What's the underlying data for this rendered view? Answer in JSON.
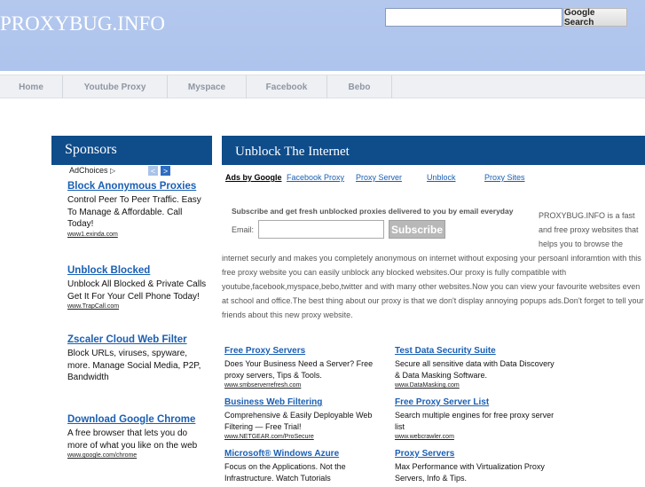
{
  "header": {
    "logo": "PROXYBUG.INFO",
    "search_button": "Google Search"
  },
  "nav": [
    "Home",
    "Youtube Proxy",
    "Myspace",
    "Facebook",
    "Bebo"
  ],
  "sidebar": {
    "title": "Sponsors",
    "adchoices": "AdChoices",
    "ads": [
      {
        "title": "Block Anonymous Proxies",
        "desc": "Control Peer To Peer Traffic. Easy To Manage & Affordable. Call Today!",
        "url": "www1.exinda.com"
      },
      {
        "title": "Unblock Blocked",
        "desc": "Unblock All Blocked & Private Calls Get It For Your Cell Phone Today!",
        "url": "www.TrapCall.com"
      },
      {
        "title": "Zscaler Cloud Web Filter",
        "desc": "Block URLs, viruses, spyware, more. Manage Social Media, P2P, Bandwidth",
        "url": ""
      },
      {
        "title": "Download Google Chrome",
        "desc": "A free browser that lets you do more of what you like on the web",
        "url": "www.google.com/chrome"
      }
    ]
  },
  "main": {
    "title": "Unblock The Internet",
    "ads_by": "Ads by Google",
    "ad_links": [
      "Facebook Proxy",
      "Proxy Server",
      "Unblock",
      "Proxy Sites"
    ],
    "subscribe_text": "Subscribe and get fresh unblocked proxies delivered to you by email everyday",
    "email_label": "Email:",
    "subscribe_button": "Subscribe",
    "description_right": "PROXYBUG.INFO is a fast and free proxy websites that helps you to browse the",
    "description_main": "internet securly and makes you completely anonymous on internet without exposing your persoanl inforamtion with this free proxy website you can easily unblock any blocked websites.Our proxy is fully compatible with youtube,facebook,myspace,bebo,twitter and with many other websites.Now you can view your favourite websites even at school and office.The best thing about our proxy is that we don't display annoying popups ads.Don't forget to tell your friends about this new proxy website."
  },
  "bottom_ads": [
    {
      "title": "Free Proxy Servers",
      "desc": "Does Your Business Need a Server? Free proxy servers, Tips & Tools.",
      "url": "www.smbserverrefresh.com"
    },
    {
      "title": "Test Data Security Suite",
      "desc": "Secure all sensitive data with Data Discovery & Data Masking Software.",
      "url": "www.DataMasking.com"
    },
    {
      "title": "Business Web Filtering",
      "desc": "Comprehensive & Easily Deployable Web Filtering — Free Trial!",
      "url": "www.NETGEAR.com/ProSecure"
    },
    {
      "title": "Free Proxy Server List",
      "desc": "Search multiple engines for free proxy server list",
      "url": "www.webcrawler.com"
    },
    {
      "title": "Microsoft® Windows Azure",
      "desc": "Focus on the Applications. Not the Infrastructure. Watch Tutorials",
      "url": ""
    },
    {
      "title": "Proxy Servers",
      "desc": "Max Performance with Virtualization Proxy Servers, Info & Tips.",
      "url": ""
    }
  ],
  "colors": {
    "header_bg": "#b0c6ed",
    "panel_head": "#0f4c8a",
    "link": "#1a5fb4"
  }
}
